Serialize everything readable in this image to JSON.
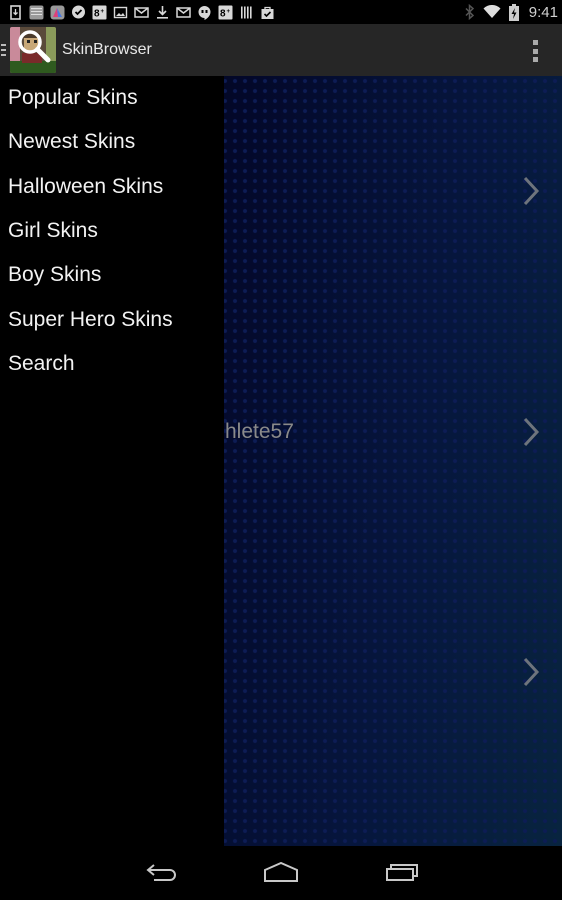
{
  "status_bar": {
    "notification_icons": [
      "sim-download-icon",
      "calendar-news-icon",
      "colorful-app-icon",
      "chat-check-icon",
      "google-plus-icon",
      "image-icon",
      "gmail-icon",
      "download-icon",
      "gmail-icon",
      "hangouts-icon",
      "google-plus-icon",
      "barcode-icon",
      "shopping-bag-icon"
    ],
    "google_plus_glyph": "8+",
    "time": "9:41",
    "system_icons": [
      "bluetooth-icon",
      "wifi-icon",
      "battery-charging-icon"
    ]
  },
  "action_bar": {
    "title": "SkinBrowser",
    "overflow_icon": "overflow-menu-icon"
  },
  "drawer": {
    "items": [
      {
        "label": "Popular Skins"
      },
      {
        "label": "Newest Skins"
      },
      {
        "label": "Halloween Skins"
      },
      {
        "label": "Girl Skins"
      },
      {
        "label": "Boy Skins"
      },
      {
        "label": "Super Hero Skins"
      },
      {
        "label": "Search"
      }
    ]
  },
  "content": {
    "rows": [
      {
        "label": ""
      },
      {
        "label": "hlete57"
      },
      {
        "label": ""
      }
    ]
  },
  "nav_bar": {
    "buttons": [
      "back",
      "home",
      "recent-apps"
    ]
  },
  "colors": {
    "action_bar_bg": "#262626",
    "drawer_bg": "#000000",
    "drawer_text": "#f2f2f2",
    "content_text": "#8a8a8a",
    "chevron": "#6e747c",
    "content_dot": "#0d1c55"
  }
}
